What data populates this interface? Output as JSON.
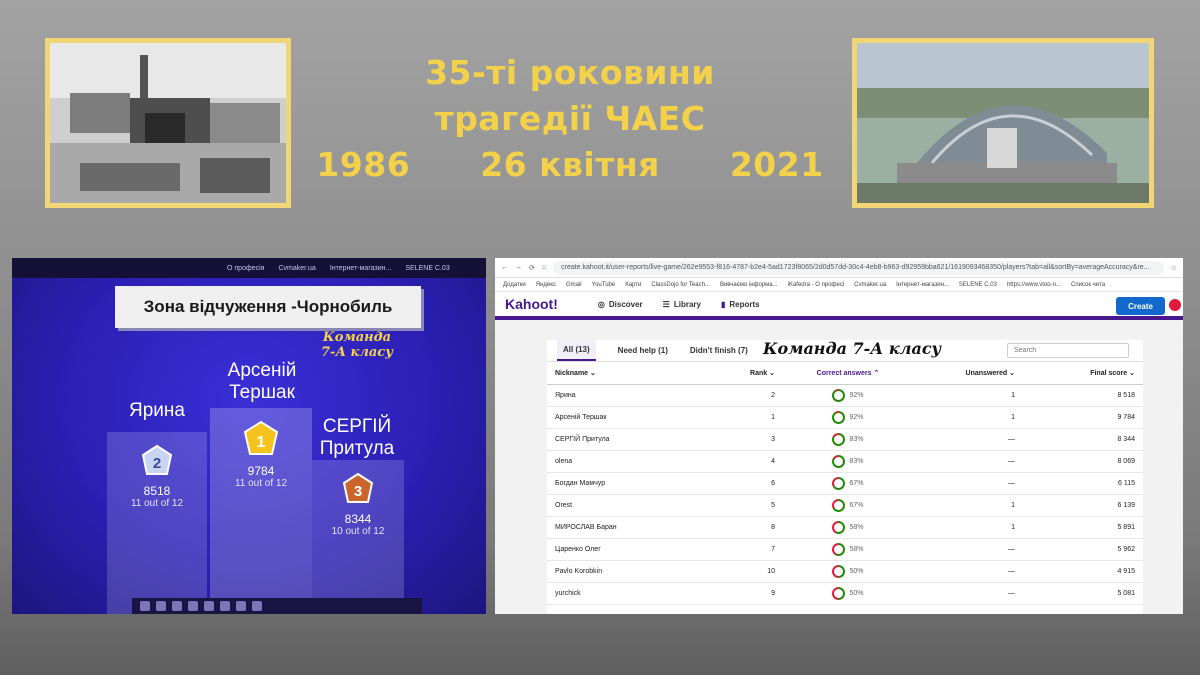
{
  "title": {
    "line1": "35-ті роковини",
    "line2": "трагедії ЧАЕС",
    "year_start": "1986",
    "date": "26 квітня",
    "year_end": "2021"
  },
  "colors": {
    "title_yellow": "#f3d24a",
    "kahoot_purple": "#46178f",
    "create_blue": "#1368ce"
  },
  "podium": {
    "taskbar": [
      "О професія",
      "Cvmaker.ua",
      "Інтернет-магазин...",
      "SELENE C.03"
    ],
    "banner": "Зона відчуження -Чорнобиль",
    "team_line1": "Команда",
    "team_line2": "7-А класу",
    "places": [
      {
        "rank": "2",
        "name_line1": "Ярина",
        "name_line2": "",
        "score": "8518",
        "correct": "11 out of 12"
      },
      {
        "rank": "1",
        "name_line1": "Арсеній",
        "name_line2": "Тершак",
        "score": "9784",
        "correct": "11 out of 12"
      },
      {
        "rank": "3",
        "name_line1": "СЕРГІЙ",
        "name_line2": "Притула",
        "score": "8344",
        "correct": "10 out of 12"
      }
    ]
  },
  "report": {
    "url": "create.kahoot.it/user-reports/live-game/262e9553-f816-4787-b2e4-5ad1723f8065/2d0d57dd-30c4-4eb8-b963-d92959bba621/1619093468350/players?tab=all&sortBy=averageAccuracy&re...",
    "bookmarks": [
      "Додатки",
      "Яндекс",
      "Gmail",
      "YouTube",
      "Карти",
      "ClassDojo for Teach...",
      "Вивчаємо інформа...",
      "iKafedra - О професі",
      "Cvmaker.ua",
      "Інтернет-магазин...",
      "SELENE C.03",
      "https://www.vtoo-n...",
      "Список чита"
    ],
    "nav": {
      "logo": "Kahoot!",
      "discover": "Discover",
      "library": "Library",
      "reports": "Reports",
      "create": "Create"
    },
    "tabs": {
      "all": "All (13)",
      "need_help": "Need help (1)",
      "didnt_finish": "Didn't finish (7)"
    },
    "team_label": "Команда 7-А класу",
    "search_placeholder": "Search",
    "columns": {
      "nickname": "Nickname",
      "rank": "Rank",
      "correct": "Correct answers",
      "unanswered": "Unanswered",
      "final": "Final score"
    },
    "rows": [
      {
        "nick": "Ярина",
        "rank": "2",
        "pct": "92%",
        "pct_value": 92,
        "unanswered": "1",
        "score": "8 518"
      },
      {
        "nick": "Арсеній Тершак",
        "rank": "1",
        "pct": "92%",
        "pct_value": 92,
        "unanswered": "1",
        "score": "9 784"
      },
      {
        "nick": "СЕРГІЙ Притула",
        "rank": "3",
        "pct": "83%",
        "pct_value": 83,
        "unanswered": "—",
        "score": "8 344"
      },
      {
        "nick": "olena",
        "rank": "4",
        "pct": "83%",
        "pct_value": 83,
        "unanswered": "—",
        "score": "8 069"
      },
      {
        "nick": "Богдан Мамчур",
        "rank": "6",
        "pct": "67%",
        "pct_value": 67,
        "unanswered": "—",
        "score": "6 115"
      },
      {
        "nick": "Orest",
        "rank": "5",
        "pct": "67%",
        "pct_value": 67,
        "unanswered": "1",
        "score": "6 139"
      },
      {
        "nick": "МИРОСЛАВ Баран",
        "rank": "8",
        "pct": "58%",
        "pct_value": 58,
        "unanswered": "1",
        "score": "5 891"
      },
      {
        "nick": "Царенко Олег",
        "rank": "7",
        "pct": "58%",
        "pct_value": 58,
        "unanswered": "—",
        "score": "5 962"
      },
      {
        "nick": "Pavlo Korobkin",
        "rank": "10",
        "pct": "50%",
        "pct_value": 50,
        "unanswered": "—",
        "score": "4 915"
      },
      {
        "nick": "yurchick",
        "rank": "9",
        "pct": "50%",
        "pct_value": 50,
        "unanswered": "—",
        "score": "5 081"
      }
    ]
  }
}
